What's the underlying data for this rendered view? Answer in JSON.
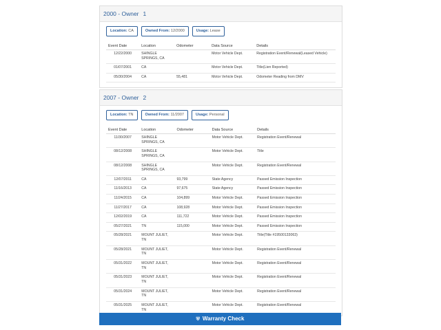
{
  "colors": {
    "accent": "#2d5f9a",
    "button_bg": "#1f6fbe"
  },
  "owners": [
    {
      "title": "2000 - Owner",
      "number": "1",
      "chips": [
        {
          "label": "Location:",
          "value": "CA"
        },
        {
          "label": "Owned From:",
          "value": "12/2000"
        },
        {
          "label": "Usage:",
          "value": "Lease"
        }
      ],
      "columns": [
        "Event Date",
        "Location",
        "Odometer",
        "Data Source",
        "Details"
      ],
      "rows": [
        {
          "date": "12/22/2000",
          "location": "SHINGLE\nSPRINGS, CA",
          "odometer": "",
          "source": "Motor Vehicle Dept.",
          "details": "Registration Event/Renewal(Leased Vehicle)"
        },
        {
          "date": "01/07/2001",
          "location": "CA",
          "odometer": "",
          "source": "Motor Vehicle Dept.",
          "details": "Title(Lien Reported)"
        },
        {
          "date": "05/30/2004",
          "location": "CA",
          "odometer": "55,481",
          "source": "Motor Vehicle Dept.",
          "details": "Odometer Reading from DMV"
        }
      ]
    },
    {
      "title": "2007 - Owner",
      "number": "2",
      "chips": [
        {
          "label": "Location:",
          "value": "TN"
        },
        {
          "label": "Owned From:",
          "value": "11/2007"
        },
        {
          "label": "Usage:",
          "value": "Personal"
        }
      ],
      "columns": [
        "Event Date",
        "Location",
        "Odometer",
        "Data Source",
        "Details"
      ],
      "rows": [
        {
          "date": "11/30/2007",
          "location": "SHINGLE\nSPRINGS, CA",
          "odometer": "",
          "source": "Motor Vehicle Dept.",
          "details": "Registration Event/Renewal"
        },
        {
          "date": "08/12/2008",
          "location": "SHINGLE\nSPRINGS, CA",
          "odometer": "",
          "source": "Motor Vehicle Dept.",
          "details": "Title"
        },
        {
          "date": "08/12/2008",
          "location": "SHINGLE\nSPRINGS, CA",
          "odometer": "",
          "source": "Motor Vehicle Dept.",
          "details": "Registration Event/Renewal"
        },
        {
          "date": "12/07/2011",
          "location": "CA",
          "odometer": "93,799",
          "source": "State Agency",
          "details": "Passed Emission Inspection"
        },
        {
          "date": "11/16/2013",
          "location": "CA",
          "odometer": "97,675",
          "source": "State Agency",
          "details": "Passed Emission Inspection"
        },
        {
          "date": "11/24/2015",
          "location": "CA",
          "odometer": "104,899",
          "source": "Motor Vehicle Dept.",
          "details": "Passed Emission Inspection"
        },
        {
          "date": "11/27/2017",
          "location": "CA",
          "odometer": "108,928",
          "source": "Motor Vehicle Dept.",
          "details": "Passed Emission Inspection"
        },
        {
          "date": "12/02/2019",
          "location": "CA",
          "odometer": "111,722",
          "source": "Motor Vehicle Dept.",
          "details": "Passed Emission Inspection"
        },
        {
          "date": "05/27/2021",
          "location": "TN",
          "odometer": "115,000",
          "source": "Motor Vehicle Dept.",
          "details": "Passed Emission Inspection"
        },
        {
          "date": "05/28/2021",
          "location": "MOUNT JULIET,\nTN",
          "odometer": "",
          "source": "Motor Vehicle Dept.",
          "details": "Title(Title #195001330​63)"
        },
        {
          "date": "05/28/2021",
          "location": "MOUNT JULIET,\nTN",
          "odometer": "",
          "source": "Motor Vehicle Dept.",
          "details": "Registration Event/Renewal"
        },
        {
          "date": "05/31/2022",
          "location": "MOUNT JULIET,\nTN",
          "odometer": "",
          "source": "Motor Vehicle Dept.",
          "details": "Registration Event/Renewal"
        },
        {
          "date": "05/31/2023",
          "location": "MOUNT JULIET,\nTN",
          "odometer": "",
          "source": "Motor Vehicle Dept.",
          "details": "Registration Event/Renewal"
        },
        {
          "date": "05/31/2024",
          "location": "MOUNT JULIET,\nTN",
          "odometer": "",
          "source": "Motor Vehicle Dept.",
          "details": "Registration Event/Renewal"
        },
        {
          "date": "05/31/2025",
          "location": "MOUNT JULIET,\nTN",
          "odometer": "",
          "source": "Motor Vehicle Dept.",
          "details": "Registration Event/Renewal"
        }
      ]
    }
  ],
  "warranty": {
    "label": "Warranty Check",
    "icon": "shield-icon"
  }
}
